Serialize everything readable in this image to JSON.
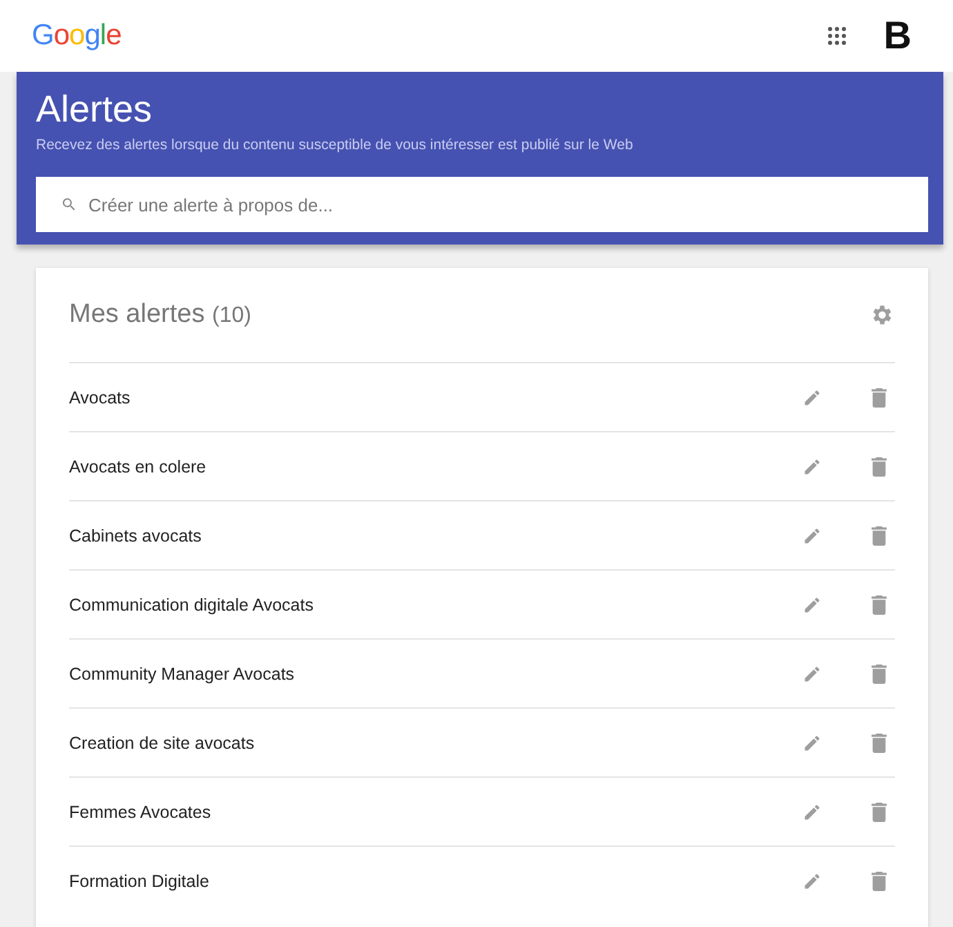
{
  "header": {
    "logo": "Google",
    "account": "B"
  },
  "banner": {
    "title": "Alertes",
    "subtitle": "Recevez des alertes lorsque du contenu susceptible de vous intéresser est publié sur le Web",
    "search": {
      "placeholder": "Créer une alerte à propos de..."
    }
  },
  "alerts": {
    "title": "Mes alertes",
    "count": "(10)",
    "items": [
      {
        "name": "Avocats"
      },
      {
        "name": "Avocats en colere"
      },
      {
        "name": "Cabinets avocats"
      },
      {
        "name": "Communication digitale Avocats"
      },
      {
        "name": "Community Manager Avocats"
      },
      {
        "name": "Creation de site avocats"
      },
      {
        "name": "Femmes Avocates"
      },
      {
        "name": "Formation Digitale"
      }
    ]
  }
}
